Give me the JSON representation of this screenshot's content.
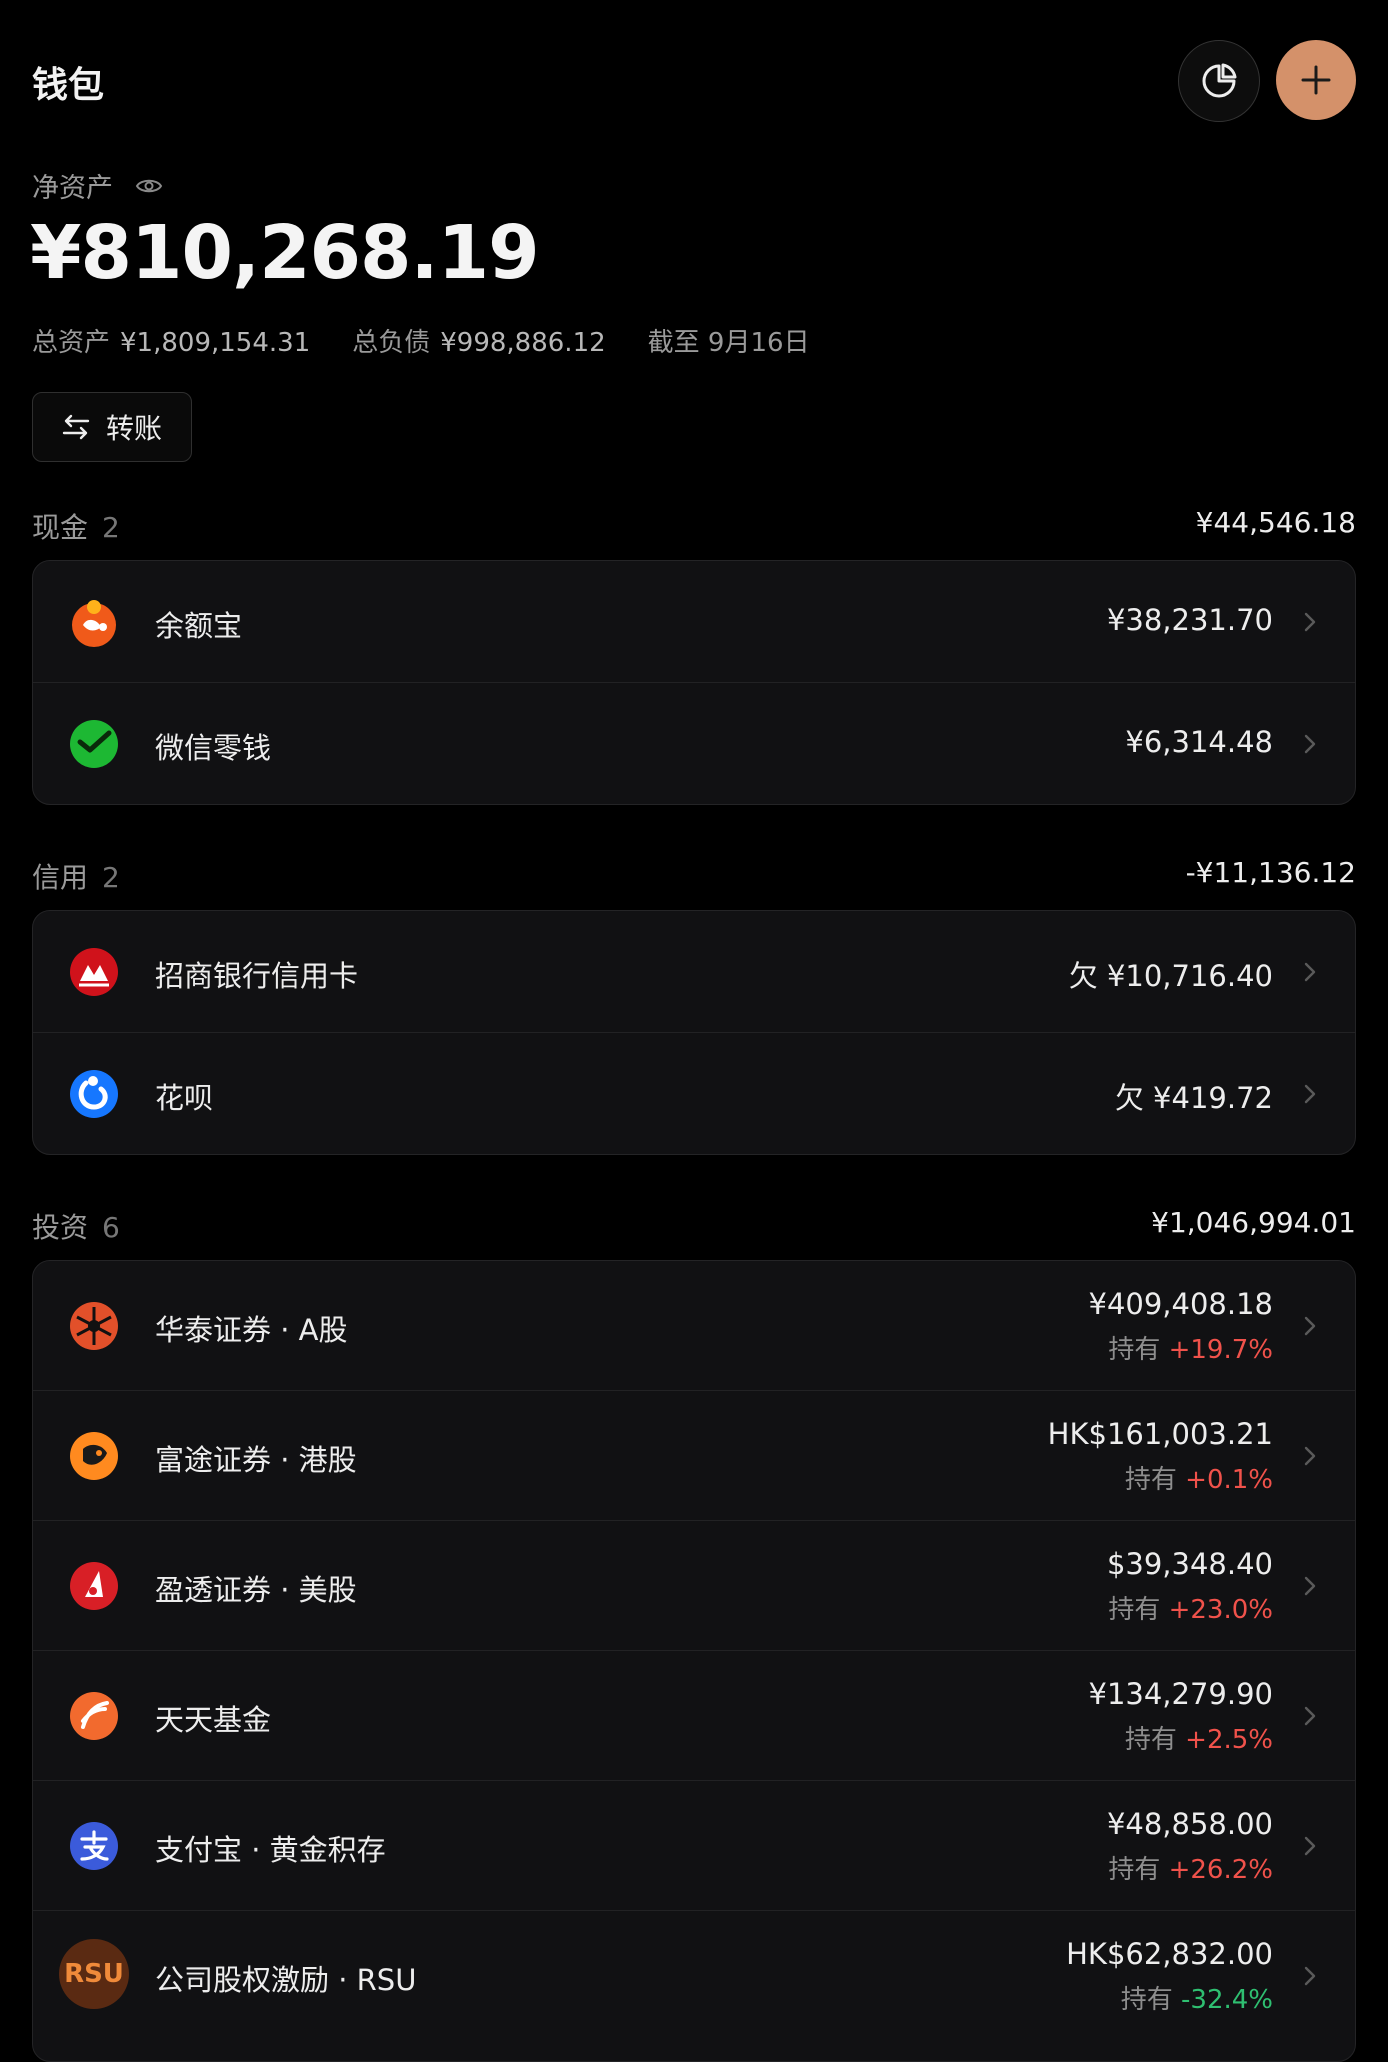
{
  "header": {
    "title": "钱包"
  },
  "net": {
    "label": "净资产",
    "value": "¥810,268.19",
    "total_assets_label": "总资产",
    "total_assets": "¥1,809,154.31",
    "total_liab_label": "总负债",
    "total_liab": "¥998,886.12",
    "as_of": "截至 9月16日"
  },
  "transfer_label": "转账",
  "sections": [
    {
      "name": "现金",
      "count": "2",
      "total": "¥44,546.18",
      "items": [
        {
          "name": "余额宝",
          "amount": "¥38,231.70",
          "icon": "yuebao-icon"
        },
        {
          "name": "微信零钱",
          "amount": "¥6,314.48",
          "icon": "wechat-icon"
        }
      ]
    },
    {
      "name": "信用",
      "count": "2",
      "total": "-¥11,136.12",
      "items": [
        {
          "name": "招商银行信用卡",
          "amount": "欠 ¥10,716.40",
          "icon": "cmb-icon"
        },
        {
          "name": "花呗",
          "amount": "欠 ¥419.72",
          "icon": "huabei-icon"
        }
      ]
    },
    {
      "name": "投资",
      "count": "6",
      "total": "¥1,046,994.01",
      "items": [
        {
          "name": "华泰证券 · A股",
          "amount": "¥409,408.18",
          "hold_label": "持有",
          "change": "+19.7%",
          "icon": "huatai-icon"
        },
        {
          "name": "富途证券 · 港股",
          "amount": "HK$161,003.21",
          "hold_label": "持有",
          "change": "+0.1%",
          "icon": "futu-icon"
        },
        {
          "name": "盈透证券 · 美股",
          "amount": "$39,348.40",
          "hold_label": "持有",
          "change": "+23.0%",
          "icon": "ibkr-icon"
        },
        {
          "name": "天天基金",
          "amount": "¥134,279.90",
          "hold_label": "持有",
          "change": "+2.5%",
          "icon": "tiantian-icon"
        },
        {
          "name": "支付宝 · 黄金积存",
          "amount": "¥48,858.00",
          "hold_label": "持有",
          "change": "+26.2%",
          "icon": "alipay-icon"
        },
        {
          "name": "公司股权激励 · RSU",
          "amount": "HK$62,832.00",
          "hold_label": "持有",
          "change": "-32.4%",
          "icon": "rsu-icon",
          "logo_text": "RSU"
        }
      ]
    }
  ],
  "colors": {
    "accent": "#D4916A",
    "gain": "#F0524B",
    "loss": "#2FBF71",
    "bg": "#000000",
    "card": "#111113"
  }
}
